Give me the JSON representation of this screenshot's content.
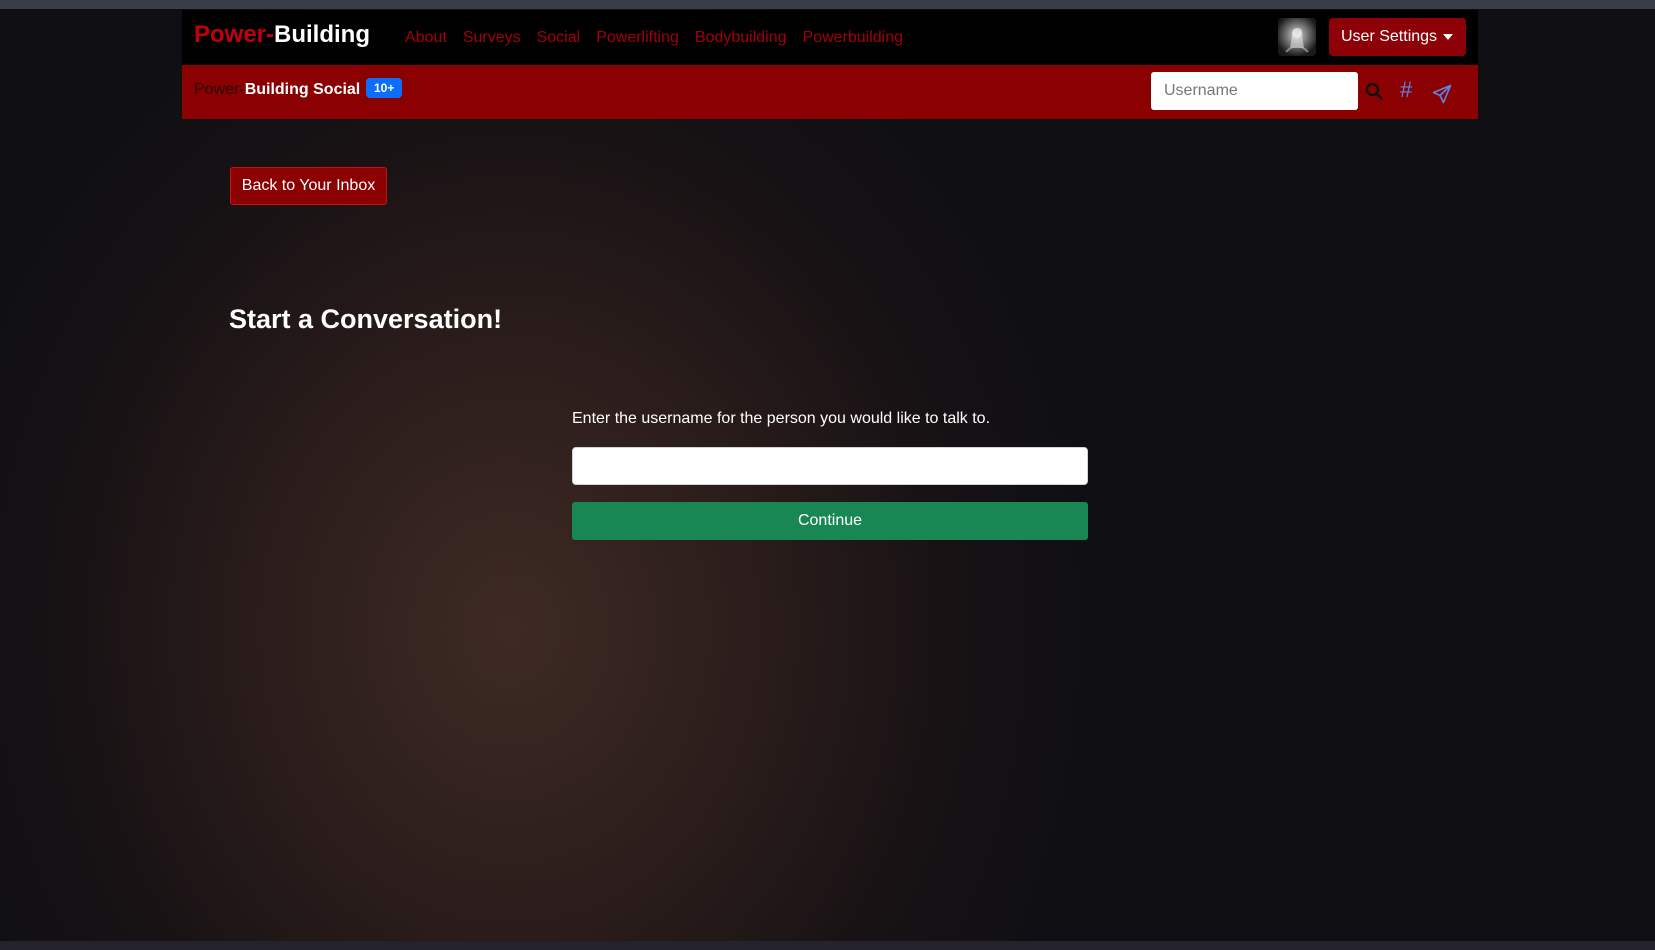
{
  "navbar": {
    "brand_part1": "Power-",
    "brand_part2": "Building",
    "links": [
      {
        "label": "About"
      },
      {
        "label": "Surveys"
      },
      {
        "label": "Social"
      },
      {
        "label": "Powerlifting"
      },
      {
        "label": "Bodybuilding"
      },
      {
        "label": "Powerbuilding"
      }
    ],
    "avatar_icon": "user-avatar",
    "user_settings_label": "User Settings"
  },
  "subbar": {
    "brand_part1": "Power-",
    "brand_part2": "Building Social",
    "badge": "10+",
    "search": {
      "placeholder": "Username",
      "value": ""
    },
    "icons": [
      "search-icon",
      "hash-icon",
      "send-icon"
    ],
    "hash_symbol": "#"
  },
  "main": {
    "back_button_label": "Back to Your Inbox",
    "title": "Start a Conversation!",
    "instruction": "Enter the username for the person you would like to talk to.",
    "username_value": "",
    "continue_label": "Continue"
  },
  "colors": {
    "brand_red": "#c0000b",
    "subbar_red": "#8b0000",
    "continue_green": "#198754",
    "badge_blue": "#0d6efd",
    "icon_blue": "#5b86e5"
  }
}
